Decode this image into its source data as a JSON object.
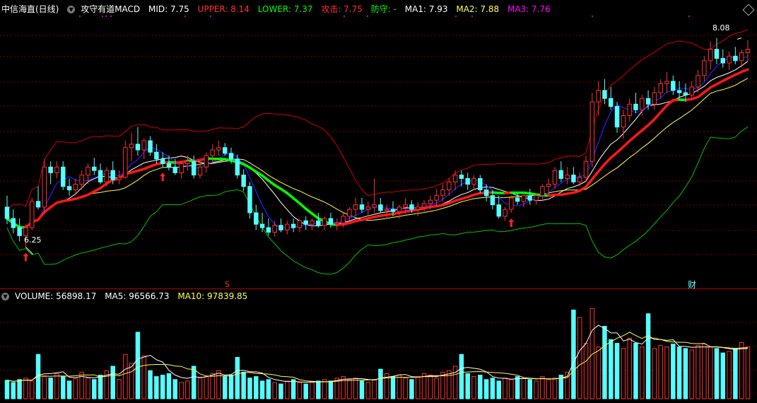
{
  "header": {
    "stock_name": "中信海直(日线)",
    "indicator_name": "攻守有道MACD",
    "mid_label": "MID: 7.75",
    "upper_label": "UPPER: 8.14",
    "lower_label": "LOWER: 7.37",
    "attack_label": "攻击: 7.75",
    "defend_label": "防守: -",
    "ma1_label": "MA1: 7.93",
    "ma2_label": "MA2: 7.88",
    "ma3_label": "MA3: 7.76"
  },
  "volume_header": {
    "volume_label": "VOLUME: 56898.17",
    "ma5_label": "MA5: 96566.73",
    "ma10_label": "MA10: 97839.85"
  },
  "annotations": {
    "high_label": "8.08",
    "low_label": "6.25",
    "marker_s": "S",
    "marker_finance": "财"
  },
  "colors": {
    "background": "#000000",
    "grid": "#7a0000",
    "up_candle": "#ff3232",
    "down_candle": "#54ffff",
    "upper_band": "#d00000",
    "lower_band": "#00c000",
    "ma1": "#ffffff",
    "ma2": "#ffff50",
    "ma3": "#ff00ff",
    "attack": "#ff1818",
    "defend": "#00ff00",
    "trend_blue": "#2020ff"
  },
  "chart_data": [
    {
      "type": "candlestick",
      "ylim": [
        5.95,
        8.25
      ],
      "high_point": 8.08,
      "low_point": 6.25,
      "candles": [
        {
          "o": 6.6,
          "h": 6.7,
          "l": 6.45,
          "c": 6.5
        },
        {
          "o": 6.5,
          "h": 6.58,
          "l": 6.37,
          "c": 6.42
        },
        {
          "o": 6.42,
          "h": 6.5,
          "l": 6.3,
          "c": 6.35
        },
        {
          "o": 6.35,
          "h": 6.45,
          "l": 6.25,
          "c": 6.42
        },
        {
          "o": 6.42,
          "h": 6.68,
          "l": 6.4,
          "c": 6.65
        },
        {
          "o": 6.65,
          "h": 6.78,
          "l": 6.58,
          "c": 6.6
        },
        {
          "o": 6.6,
          "h": 7.02,
          "l": 6.55,
          "c": 6.95
        },
        {
          "o": 6.95,
          "h": 7.0,
          "l": 6.8,
          "c": 6.9
        },
        {
          "o": 6.9,
          "h": 7.0,
          "l": 6.85,
          "c": 6.95
        },
        {
          "o": 6.95,
          "h": 7.0,
          "l": 6.75,
          "c": 6.78
        },
        {
          "o": 6.78,
          "h": 6.85,
          "l": 6.7,
          "c": 6.75
        },
        {
          "o": 6.75,
          "h": 6.85,
          "l": 6.7,
          "c": 6.8
        },
        {
          "o": 6.8,
          "h": 6.92,
          "l": 6.75,
          "c": 6.88
        },
        {
          "o": 6.88,
          "h": 6.98,
          "l": 6.8,
          "c": 6.95
        },
        {
          "o": 6.95,
          "h": 7.03,
          "l": 6.88,
          "c": 6.92
        },
        {
          "o": 6.92,
          "h": 6.98,
          "l": 6.8,
          "c": 6.82
        },
        {
          "o": 6.82,
          "h": 6.95,
          "l": 6.78,
          "c": 6.92
        },
        {
          "o": 6.92,
          "h": 7.0,
          "l": 6.8,
          "c": 6.84
        },
        {
          "o": 6.84,
          "h": 6.92,
          "l": 6.8,
          "c": 6.86
        },
        {
          "o": 6.86,
          "h": 7.18,
          "l": 6.85,
          "c": 7.12
        },
        {
          "o": 7.12,
          "h": 7.25,
          "l": 7.0,
          "c": 7.15
        },
        {
          "o": 7.15,
          "h": 7.3,
          "l": 7.05,
          "c": 7.1
        },
        {
          "o": 7.1,
          "h": 7.2,
          "l": 7.02,
          "c": 7.18
        },
        {
          "o": 7.18,
          "h": 7.22,
          "l": 7.05,
          "c": 7.08
        },
        {
          "o": 7.08,
          "h": 7.15,
          "l": 6.98,
          "c": 7.02
        },
        {
          "o": 7.02,
          "h": 7.08,
          "l": 6.95,
          "c": 6.98
        },
        {
          "o": 6.98,
          "h": 7.05,
          "l": 6.92,
          "c": 6.95
        },
        {
          "o": 6.95,
          "h": 7.02,
          "l": 6.88,
          "c": 6.9
        },
        {
          "o": 6.9,
          "h": 7.0,
          "l": 6.85,
          "c": 6.98
        },
        {
          "o": 6.98,
          "h": 7.05,
          "l": 6.92,
          "c": 7.0
        },
        {
          "o": 7.0,
          "h": 7.05,
          "l": 6.85,
          "c": 6.88
        },
        {
          "o": 6.88,
          "h": 7.0,
          "l": 6.85,
          "c": 6.95
        },
        {
          "o": 6.95,
          "h": 7.08,
          "l": 6.9,
          "c": 7.05
        },
        {
          "o": 7.05,
          "h": 7.15,
          "l": 7.0,
          "c": 7.1
        },
        {
          "o": 7.1,
          "h": 7.18,
          "l": 7.05,
          "c": 7.12
        },
        {
          "o": 7.12,
          "h": 7.16,
          "l": 7.05,
          "c": 7.07
        },
        {
          "o": 7.07,
          "h": 7.12,
          "l": 6.98,
          "c": 7.02
        },
        {
          "o": 7.02,
          "h": 7.06,
          "l": 6.85,
          "c": 6.88
        },
        {
          "o": 6.88,
          "h": 6.93,
          "l": 6.74,
          "c": 6.78
        },
        {
          "o": 6.78,
          "h": 6.82,
          "l": 6.5,
          "c": 6.55
        },
        {
          "o": 6.55,
          "h": 6.62,
          "l": 6.4,
          "c": 6.45
        },
        {
          "o": 6.45,
          "h": 6.55,
          "l": 6.38,
          "c": 6.42
        },
        {
          "o": 6.42,
          "h": 6.5,
          "l": 6.35,
          "c": 6.38
        },
        {
          "o": 6.38,
          "h": 6.48,
          "l": 6.34,
          "c": 6.44
        },
        {
          "o": 6.44,
          "h": 6.5,
          "l": 6.38,
          "c": 6.4
        },
        {
          "o": 6.4,
          "h": 6.48,
          "l": 6.36,
          "c": 6.45
        },
        {
          "o": 6.45,
          "h": 6.5,
          "l": 6.38,
          "c": 6.42
        },
        {
          "o": 6.42,
          "h": 6.5,
          "l": 6.38,
          "c": 6.48
        },
        {
          "o": 6.48,
          "h": 6.52,
          "l": 6.4,
          "c": 6.45
        },
        {
          "o": 6.45,
          "h": 6.5,
          "l": 6.4,
          "c": 6.48
        },
        {
          "o": 6.48,
          "h": 6.55,
          "l": 6.42,
          "c": 6.44
        },
        {
          "o": 6.44,
          "h": 6.52,
          "l": 6.4,
          "c": 6.5
        },
        {
          "o": 6.5,
          "h": 6.55,
          "l": 6.42,
          "c": 6.45
        },
        {
          "o": 6.45,
          "h": 6.5,
          "l": 6.4,
          "c": 6.46
        },
        {
          "o": 6.46,
          "h": 6.55,
          "l": 6.42,
          "c": 6.52
        },
        {
          "o": 6.52,
          "h": 6.6,
          "l": 6.48,
          "c": 6.58
        },
        {
          "o": 6.58,
          "h": 6.68,
          "l": 6.52,
          "c": 6.62
        },
        {
          "o": 6.62,
          "h": 6.68,
          "l": 6.55,
          "c": 6.58
        },
        {
          "o": 6.58,
          "h": 6.65,
          "l": 6.52,
          "c": 6.6
        },
        {
          "o": 6.6,
          "h": 6.85,
          "l": 6.55,
          "c": 6.62
        },
        {
          "o": 6.62,
          "h": 6.68,
          "l": 6.55,
          "c": 6.57
        },
        {
          "o": 6.57,
          "h": 6.62,
          "l": 6.5,
          "c": 6.58
        },
        {
          "o": 6.58,
          "h": 6.65,
          "l": 6.52,
          "c": 6.56
        },
        {
          "o": 6.56,
          "h": 6.62,
          "l": 6.5,
          "c": 6.6
        },
        {
          "o": 6.6,
          "h": 6.68,
          "l": 6.54,
          "c": 6.62
        },
        {
          "o": 6.62,
          "h": 6.66,
          "l": 6.55,
          "c": 6.58
        },
        {
          "o": 6.58,
          "h": 6.64,
          "l": 6.52,
          "c": 6.6
        },
        {
          "o": 6.6,
          "h": 6.66,
          "l": 6.55,
          "c": 6.63
        },
        {
          "o": 6.63,
          "h": 6.7,
          "l": 6.58,
          "c": 6.66
        },
        {
          "o": 6.66,
          "h": 6.76,
          "l": 6.6,
          "c": 6.7
        },
        {
          "o": 6.7,
          "h": 6.8,
          "l": 6.65,
          "c": 6.75
        },
        {
          "o": 6.75,
          "h": 6.85,
          "l": 6.7,
          "c": 6.82
        },
        {
          "o": 6.82,
          "h": 6.92,
          "l": 6.75,
          "c": 6.88
        },
        {
          "o": 6.88,
          "h": 6.92,
          "l": 6.78,
          "c": 6.85
        },
        {
          "o": 6.85,
          "h": 6.9,
          "l": 6.75,
          "c": 6.8
        },
        {
          "o": 6.8,
          "h": 6.88,
          "l": 6.75,
          "c": 6.85
        },
        {
          "o": 6.85,
          "h": 6.88,
          "l": 6.72,
          "c": 6.75
        },
        {
          "o": 6.75,
          "h": 6.8,
          "l": 6.65,
          "c": 6.7
        },
        {
          "o": 6.7,
          "h": 6.75,
          "l": 6.58,
          "c": 6.62
        },
        {
          "o": 6.62,
          "h": 6.7,
          "l": 6.5,
          "c": 6.52
        },
        {
          "o": 6.52,
          "h": 6.6,
          "l": 6.48,
          "c": 6.58
        },
        {
          "o": 6.58,
          "h": 6.7,
          "l": 6.55,
          "c": 6.68
        },
        {
          "o": 6.68,
          "h": 6.72,
          "l": 6.62,
          "c": 6.65
        },
        {
          "o": 6.65,
          "h": 6.72,
          "l": 6.6,
          "c": 6.7
        },
        {
          "o": 6.7,
          "h": 6.76,
          "l": 6.62,
          "c": 6.66
        },
        {
          "o": 6.66,
          "h": 6.72,
          "l": 6.62,
          "c": 6.7
        },
        {
          "o": 6.7,
          "h": 6.8,
          "l": 6.65,
          "c": 6.78
        },
        {
          "o": 6.78,
          "h": 6.85,
          "l": 6.7,
          "c": 6.8
        },
        {
          "o": 6.8,
          "h": 6.95,
          "l": 6.76,
          "c": 6.92
        },
        {
          "o": 6.92,
          "h": 7.0,
          "l": 6.82,
          "c": 6.85
        },
        {
          "o": 6.85,
          "h": 6.95,
          "l": 6.8,
          "c": 6.88
        },
        {
          "o": 6.88,
          "h": 6.95,
          "l": 6.8,
          "c": 6.82
        },
        {
          "o": 6.82,
          "h": 6.9,
          "l": 6.78,
          "c": 6.86
        },
        {
          "o": 6.86,
          "h": 7.05,
          "l": 6.82,
          "c": 7.0
        },
        {
          "o": 7.0,
          "h": 7.6,
          "l": 6.95,
          "c": 7.52
        },
        {
          "o": 7.52,
          "h": 7.7,
          "l": 7.4,
          "c": 7.62
        },
        {
          "o": 7.62,
          "h": 7.72,
          "l": 7.5,
          "c": 7.55
        },
        {
          "o": 7.55,
          "h": 7.65,
          "l": 7.45,
          "c": 7.48
        },
        {
          "o": 7.48,
          "h": 7.52,
          "l": 7.25,
          "c": 7.3
        },
        {
          "o": 7.3,
          "h": 7.45,
          "l": 7.2,
          "c": 7.4
        },
        {
          "o": 7.4,
          "h": 7.55,
          "l": 7.35,
          "c": 7.5
        },
        {
          "o": 7.5,
          "h": 7.6,
          "l": 7.42,
          "c": 7.45
        },
        {
          "o": 7.45,
          "h": 7.58,
          "l": 7.4,
          "c": 7.55
        },
        {
          "o": 7.55,
          "h": 7.62,
          "l": 7.45,
          "c": 7.5
        },
        {
          "o": 7.5,
          "h": 7.65,
          "l": 7.45,
          "c": 7.6
        },
        {
          "o": 7.6,
          "h": 7.72,
          "l": 7.55,
          "c": 7.68
        },
        {
          "o": 7.68,
          "h": 7.78,
          "l": 7.6,
          "c": 7.7
        },
        {
          "o": 7.7,
          "h": 7.75,
          "l": 7.58,
          "c": 7.62
        },
        {
          "o": 7.62,
          "h": 7.7,
          "l": 7.55,
          "c": 7.6
        },
        {
          "o": 7.6,
          "h": 7.68,
          "l": 7.52,
          "c": 7.58
        },
        {
          "o": 7.58,
          "h": 7.7,
          "l": 7.55,
          "c": 7.65
        },
        {
          "o": 7.65,
          "h": 7.8,
          "l": 7.6,
          "c": 7.75
        },
        {
          "o": 7.75,
          "h": 7.92,
          "l": 7.7,
          "c": 7.88
        },
        {
          "o": 7.88,
          "h": 8.05,
          "l": 7.8,
          "c": 7.98
        },
        {
          "o": 7.98,
          "h": 8.08,
          "l": 7.85,
          "c": 7.9
        },
        {
          "o": 7.9,
          "h": 7.98,
          "l": 7.82,
          "c": 7.86
        },
        {
          "o": 7.86,
          "h": 7.96,
          "l": 7.8,
          "c": 7.92
        },
        {
          "o": 7.92,
          "h": 8.0,
          "l": 7.85,
          "c": 7.88
        },
        {
          "o": 7.88,
          "h": 7.98,
          "l": 7.82,
          "c": 7.95
        },
        {
          "o": 7.95,
          "h": 8.06,
          "l": 7.88,
          "c": 7.98
        }
      ]
    },
    {
      "type": "bar",
      "title": "VOLUME",
      "ylim": [
        0,
        130000
      ],
      "values": [
        25000,
        22000,
        26000,
        28000,
        24000,
        60000,
        30000,
        28000,
        34000,
        30000,
        24000,
        27000,
        36000,
        28000,
        26000,
        32000,
        38000,
        44000,
        26000,
        60000,
        48000,
        90000,
        58000,
        38000,
        30000,
        32000,
        34000,
        26000,
        22000,
        24000,
        44000,
        28000,
        30000,
        34000,
        38000,
        30000,
        32000,
        56000,
        36000,
        28000,
        30000,
        24000,
        26000,
        22000,
        20000,
        24000,
        26000,
        22000,
        20000,
        22000,
        24000,
        26000,
        24000,
        28000,
        30000,
        26000,
        28000,
        24000,
        22000,
        26000,
        40000,
        34000,
        30000,
        32000,
        28000,
        26000,
        30000,
        34000,
        32000,
        28000,
        36000,
        38000,
        44000,
        60000,
        34000,
        30000,
        32000,
        26000,
        28000,
        24000,
        28000,
        26000,
        30000,
        28000,
        26000,
        24000,
        30000,
        26000,
        28000,
        32000,
        36000,
        120000,
        110000,
        75000,
        122000,
        70000,
        98000,
        80000,
        75000,
        68000,
        82000,
        75000,
        70000,
        115000,
        68000,
        72000,
        70000,
        74000,
        70000,
        68000,
        66000,
        72000,
        74000,
        70000,
        68000,
        62000,
        64000,
        68000,
        76000,
        70000
      ]
    }
  ]
}
